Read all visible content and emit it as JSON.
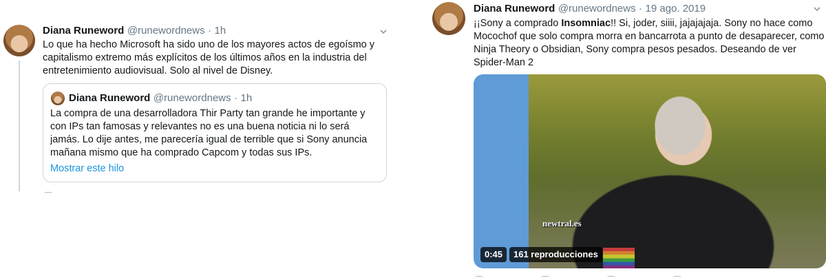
{
  "tweet_left": {
    "name": "Diana Runeword",
    "handle": "@runewordnews",
    "time": "1h",
    "text": "Lo que ha hecho Microsoft ha sido uno de los mayores actos de egoísmo y capitalismo extremo más explícitos de los últimos años en la industria del entretenimiento audiovisual. Solo al nivel de Disney.",
    "quote": {
      "name": "Diana Runeword",
      "handle": "@runewordnews",
      "time": "1h",
      "text": "La compra de una desarrolladora Thir Party tan grande he importante y con IPs tan famosas y relevantes no es una buena noticia ni lo será jamás. Lo dije antes, me parecería igual de terrible que si Sony anuncia mañana mismo que ha comprado Capcom y todas sus IPs.",
      "show_thread": "Mostrar este hilo"
    }
  },
  "tweet_right": {
    "name": "Diana Runeword",
    "handle": "@runewordnews",
    "time": "19 ago. 2019",
    "text_before": "¡¡Sony a comprado ",
    "text_bold": "Insomniac",
    "text_after": "!! Si, joder, siiii, jajajajaja. Sony no hace como Mocochof que solo compra morra en bancarrota a punto de desaparecer, como Ninja Theory o Obsidian, Sony compra pesos pesados. Deseando de ver Spider-Man 2",
    "video": {
      "duration": "0:45",
      "views": "161 reproducciones",
      "watermark": "newtral.es"
    }
  },
  "separator": "·",
  "icons": {
    "chevron": "chevron-down-icon",
    "reply": "reply-icon",
    "retweet": "retweet-icon",
    "like": "like-icon",
    "share": "share-icon"
  },
  "colors": {
    "link": "#1b95e0",
    "secondary_text": "#657786",
    "border": "#ccd6dd"
  }
}
